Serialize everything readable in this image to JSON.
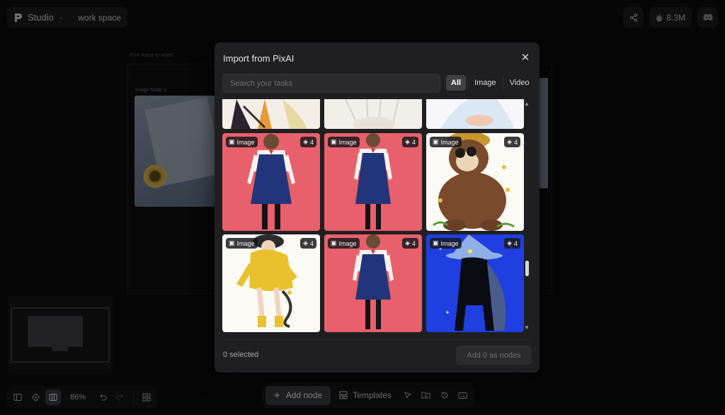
{
  "header": {
    "brand": "Studio",
    "workspace": "work space",
    "credits": "8.3M"
  },
  "canvas": {
    "frame_caption": "First frame to video",
    "node_caption": "Image Node 1"
  },
  "toolbar": {
    "zoom": "86%",
    "add_node": "Add node",
    "templates": "Templates"
  },
  "modal": {
    "title": "Import from PixAI",
    "search_placeholder": "Search your tasks",
    "filters": [
      "All",
      "Image",
      "Video"
    ],
    "active_filter": "All",
    "tiles": [
      {
        "type": "Image",
        "count": "4",
        "subject": "schoolgirl-navy-dress"
      },
      {
        "type": "Image",
        "count": "4",
        "subject": "schoolgirl-navy-dress"
      },
      {
        "type": "Image",
        "count": "4",
        "subject": "bear-binoculars"
      },
      {
        "type": "Image",
        "count": "4",
        "subject": "yellow-raincoat-girl"
      },
      {
        "type": "Image",
        "count": "4",
        "subject": "schoolgirl-navy-dress"
      },
      {
        "type": "Image",
        "count": "4",
        "subject": "blue-witch"
      }
    ],
    "selected_text": "0 selected",
    "add_button": "Add 0 as nodes"
  },
  "colors": {
    "tile_pink": "#e8606b",
    "tile_white": "#fbfaf5",
    "tile_blue": "#1f3fe0",
    "modal_bg": "#1f1f22"
  }
}
